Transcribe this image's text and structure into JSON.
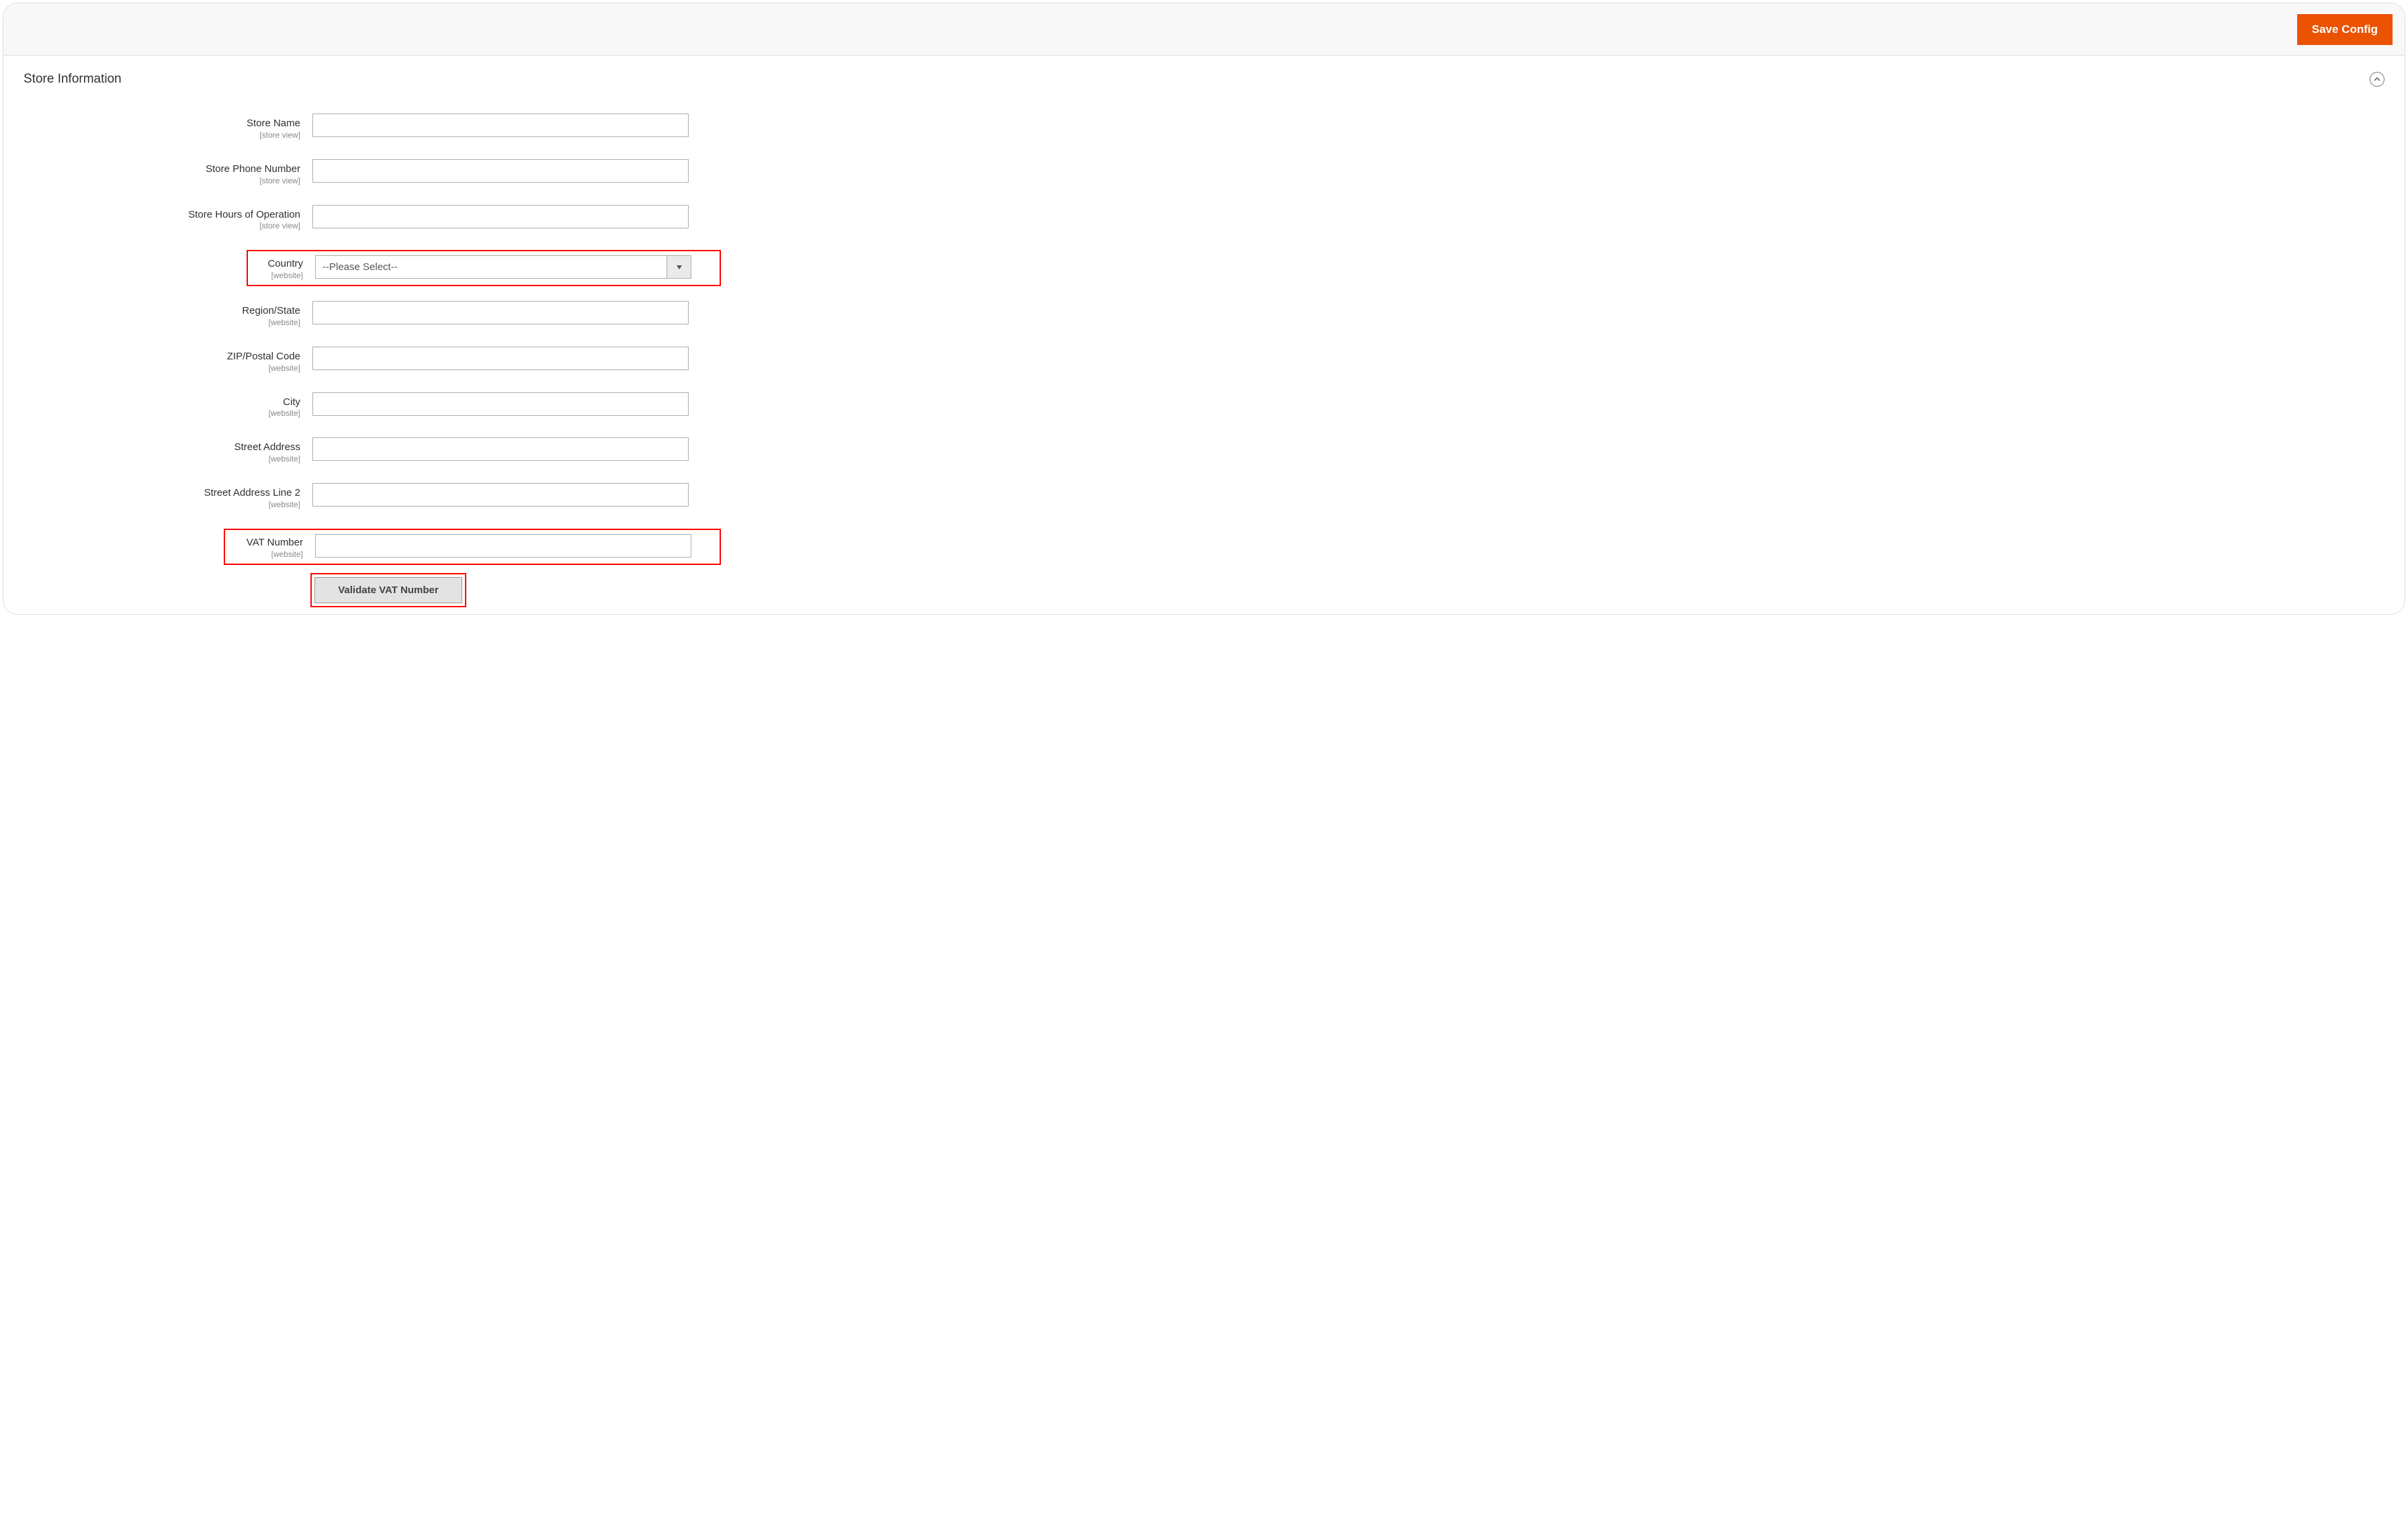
{
  "header": {
    "save_label": "Save Config"
  },
  "section": {
    "title": "Store Information"
  },
  "fields": {
    "store_name": {
      "label": "Store Name",
      "scope": "[store view]",
      "value": ""
    },
    "store_phone": {
      "label": "Store Phone Number",
      "scope": "[store view]",
      "value": ""
    },
    "store_hours": {
      "label": "Store Hours of Operation",
      "scope": "[store view]",
      "value": ""
    },
    "country": {
      "label": "Country",
      "scope": "[website]",
      "selected": "--Please Select--"
    },
    "region": {
      "label": "Region/State",
      "scope": "[website]",
      "value": ""
    },
    "zip": {
      "label": "ZIP/Postal Code",
      "scope": "[website]",
      "value": ""
    },
    "city": {
      "label": "City",
      "scope": "[website]",
      "value": ""
    },
    "street1": {
      "label": "Street Address",
      "scope": "[website]",
      "value": ""
    },
    "street2": {
      "label": "Street Address Line 2",
      "scope": "[website]",
      "value": ""
    },
    "vat": {
      "label": "VAT Number",
      "scope": "[website]",
      "value": ""
    }
  },
  "buttons": {
    "validate_vat": "Validate VAT Number"
  }
}
